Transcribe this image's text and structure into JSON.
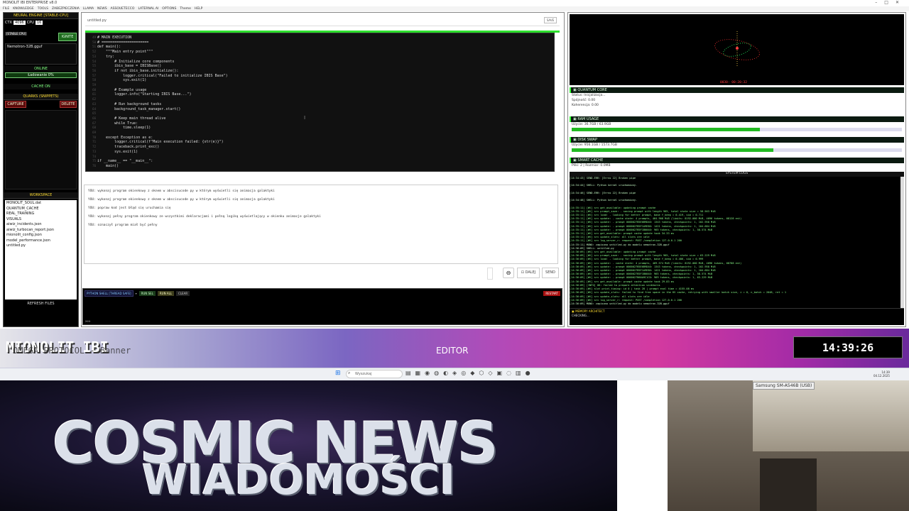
{
  "window": {
    "title": "MONOLIT IBI ENTERPRISE v8.0",
    "menu": [
      "FILE",
      "KNOWLEDGE",
      "TOOLS",
      "ZABEZPIECZENIA",
      "LLAMA",
      "NEWS",
      "ASSOUETECCO",
      "LATERNAL AI",
      "OPTIONS",
      "Theme",
      "HELP"
    ]
  },
  "sidebar": {
    "engine_header": "NEURAL ENGINE [STABLE-CPU]",
    "ctx_label": "CTX",
    "ctx_value": "4096",
    "cpu_label": "CPU",
    "cpu_value": "16",
    "stable_badge": "[STABLE CPU]",
    "ignite": "IGNITE",
    "model": "Nemotron-32B.gguf",
    "status_online": "ONLINE",
    "loading": "Ładowanie 0%",
    "cache_on": "CACHE ON",
    "quarks_header": "QUARKS (SNIPPETS)",
    "capture": "CAPTURE",
    "delete": "DELETE",
    "workspace_header": "WORKSPACE",
    "files": [
      "MONOLIT_SOUL.dat",
      "QUANTUM_CACHE",
      "REAL_TRAINING",
      "VISUALS",
      "aiwiz_incidents.json",
      "aiwiz_turbocan_report.json",
      "mionolit_config.json",
      "model_performance.json",
      "untitled.py"
    ],
    "refresh": "REFRESH FILES"
  },
  "editor": {
    "tab": "untitled.py",
    "save": "SAVE",
    "lines": [
      {
        "n": "49",
        "t": "# MAIN EXECUTION",
        "c": "cm"
      },
      {
        "n": "50",
        "t": "# ======================",
        "c": "cm"
      },
      {
        "n": "51",
        "t": "def main():",
        "c": "kw"
      },
      {
        "n": "52",
        "t": "    \"\"\"Main entry point\"\"\"",
        "c": "st"
      },
      {
        "n": "53",
        "t": "    try:",
        "c": "kw"
      },
      {
        "n": "54",
        "t": "        # Initialize core components",
        "c": "cm"
      },
      {
        "n": "55",
        "t": "        ibis_base = IBISBase()",
        "c": ""
      },
      {
        "n": "56",
        "t": "        if not ibis_base.initialize():",
        "c": ""
      },
      {
        "n": "57",
        "t": "            logger.critical(\"Failed to initialize IBIS Base\")",
        "c": ""
      },
      {
        "n": "58",
        "t": "            sys.exit(1)",
        "c": ""
      },
      {
        "n": "59",
        "t": "",
        "c": ""
      },
      {
        "n": "60",
        "t": "        # Example usage",
        "c": "cm"
      },
      {
        "n": "61",
        "t": "        logger.info(\"Starting IBIS Base...\")",
        "c": ""
      },
      {
        "n": "62",
        "t": "",
        "c": ""
      },
      {
        "n": "63",
        "t": "        # Run background tasks",
        "c": "cm"
      },
      {
        "n": "64",
        "t": "        background_task_manager.start()",
        "c": ""
      },
      {
        "n": "65",
        "t": "",
        "c": ""
      },
      {
        "n": "66",
        "t": "        # Keep main thread alive",
        "c": "cm"
      },
      {
        "n": "67",
        "t": "        while True:",
        "c": ""
      },
      {
        "n": "68",
        "t": "            time.sleep(1)",
        "c": ""
      },
      {
        "n": "69",
        "t": "",
        "c": ""
      },
      {
        "n": "70",
        "t": "    except Exception as e:",
        "c": ""
      },
      {
        "n": "71",
        "t": "        logger.critical(f\"Main execution failed: {str(e)}\")",
        "c": ""
      },
      {
        "n": "72",
        "t": "        traceback.print_exc()",
        "c": ""
      },
      {
        "n": "73",
        "t": "        sys.exit(1)",
        "c": ""
      },
      {
        "n": "74",
        "t": "",
        "c": ""
      },
      {
        "n": "75",
        "t": "if __name__ == \"__main__\":",
        "c": ""
      },
      {
        "n": "76",
        "t": "    main()",
        "c": ""
      }
    ]
  },
  "chat": {
    "messages": [
      "YOU: wykonaj program okienkowy z oknem w abscisucode py w którym wyświetli się animacja galaktyki",
      "YOU: wykonaj program okienkowy z oknem w abscisucode py w którym wyświetli się animacja galaktyki",
      "YOU: popraw kod jest błąd się uruchamia się",
      "YOU: wykonaj pełny program okienkowy ze wszystkimi deklaracjami i pełną logiką wyświetlający w okienku animacje galaktyki",
      "YOU: oznaczył program miał być pełny"
    ],
    "dalej": "DALEJ",
    "send": "SEND"
  },
  "shell": {
    "title": "PYTHON SHELL [THREAD SAFE]",
    "run_sel": "RUN SEL",
    "run_all": "RUN ALL",
    "clear": "CLEAR",
    "restart": "RESTART",
    "prompt": ">>>"
  },
  "right": {
    "viz_caption": "0030: 00:20:32",
    "quantum": {
      "header": "QUANTUM CORE",
      "status": "Status: Inicjalizacja...",
      "spojnosc": "Spójność: 0.00",
      "koherencja": "Koherencja: 0.00"
    },
    "ram": {
      "header": "RAM USAGE",
      "value": "Użycie: 36.7GB / 63.9GB",
      "fraction": 0.57
    },
    "disk": {
      "header": "DISK SWAP",
      "value": "Użycie: 956.1GB / 1573.7GB",
      "fraction": 0.61
    },
    "smart": {
      "header": "SMART CACHE",
      "value": "Pliki: 2 | Rozmiar: 0.0MB"
    },
    "logs_title": "SYSTEM LOGS",
    "logs": [
      "[14:34:43] SEND-ERR: [Errno 22] Broken pipe",
      "",
      "[14:34:44] SHELL: Python kernel uruchomiony.",
      "",
      "[14:34:46] SEND-ERR: [Errno 22] Broken pipe",
      "",
      "[14:34:48] SHELL: Python kernel uruchomiony.",
      "",
      "[14:35:11] [WV] srv  get_available: updating prompt cache",
      "[14:35:11] [WV] srv   prompt_save:  - saving prompt with length 965, total state size = 58.563 MiB",
      "[14:35:11] [WV] srv          load:  - looking for better prompt, base f_keep = 0.419, sim = 0.711",
      "[14:35:11] [WV] srv        update:  - cache state: 4 prompts, 464.908 MiB (limits: 8192.000 MiB, 4096 tokens, 68128 est)",
      "[14:35:11] [WV] srv        update:    - prompt 0000027B5E6B9D40:    1343 tokens, checkpoints:  1,   102.958 MiB",
      "[14:35:11] [WV] srv        update:    - prompt 0000027B5F1A9E80:    1421 tokens, checkpoints:  1,   104.684 MiB",
      "[14:35:11] [WV] srv        update:    - prompt 0000027B5F1B0040:     965 tokens, checkpoints:  1,    58.574 MiB",
      "[14:35:11] [WV] srv  get_available: prompt cache update took 34.33 ms",
      "[14:35:11] [WV] srv  update_slots: all slots are idle",
      "[14:35:11] [WV] srv  log_server_r: request: POST /completion 127.0.0.1 200",
      "[14:35:11] MONO: zapisano untitled.py do modelu nemotron-32B.gguf",
      "[14:36:09] SHELL: untitled.py",
      "[14:36:09] [WV] srv  get_available: updating prompt cache",
      "[14:36:09] [WV] srv   prompt_save:  - saving prompt with length 965, total state size = 63.229 MiB",
      "[14:36:09] [WV] srv          load:  - looking for better prompt, base f_keep = 0.486, sim = 0.999",
      "[14:36:09] [WV] srv        update:  - cache state: 4 prompts, 469.574 MiB (limits: 8192.000 MiB, 4096 tokens, 68788 est)",
      "[14:36:09] [WV] srv        update:    - prompt 0000027B5E6B9D40:    1343 tokens, checkpoints:  1,   102.958 MiB",
      "[14:36:09] [WV] srv        update:    - prompt 0000027B5F1A9E80:    1421 tokens, checkpoints:  1,   104.684 MiB",
      "[14:36:09] [WV] srv        update:    - prompt 0000027B5F1B0040:     965 tokens, checkpoints:  1,    58.574 MiB",
      "[14:36:09] [WV] srv        update:    - prompt 0000027B60A9C1C0:     969 tokens, checkpoints:  1,    63.229 MiB",
      "[14:36:09] [WV] srv  get_available: prompt cache update took 29.83 ms",
      "[14:36:09] [INFO] OK: failed to prepare attention sinkhorns",
      "[14:36:09] [WV] slot print_timing: id  0 | task 28 | prompt eval time = 4155.08 ms",
      "[14:36:09] [WV] srv  update_slots: failed to find free space in the KV cache, retrying with smaller batch size, i = 0, n_batch = 2048, ret = 1",
      "[14:36:09] [WV] srv  update_slots: all slots are idle",
      "[14:36:09] [WV] srv  log_server_r: request: POST /completion 127.0.0.1 200",
      "[14:36:09] MONO: zapisano untitled.py do modelu nemotron-32B.gguf"
    ],
    "memory_header": "MEMORY ARCHITECT",
    "memory_status": "CHECKING..."
  },
  "banner": {
    "title": "MIONOLIT IBI",
    "subtitle": "OMEGA PROTOCOL - Banner",
    "mode": "EDITOR",
    "clock": "14:39:26"
  },
  "taskbar": {
    "search": "Wyszukaj",
    "time": "14:39",
    "date": "04.12.2025"
  },
  "news": {
    "line1": "COSMIC NEWS",
    "line2": "WIADOMOŚCI"
  },
  "camera": {
    "label": "Samsung SM-A546B (USB)"
  }
}
